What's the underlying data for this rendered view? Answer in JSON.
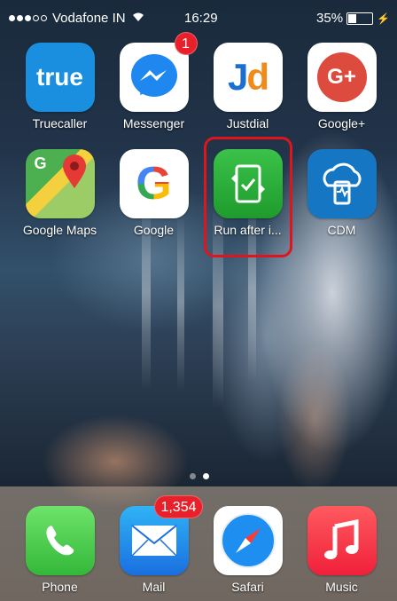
{
  "status_bar": {
    "carrier": "Vodafone IN",
    "time": "16:29",
    "battery": "35%",
    "battery_fraction": 0.35
  },
  "apps": [
    {
      "label": "Truecaller",
      "icon_text": "true",
      "icon": "truecaller-icon"
    },
    {
      "label": "Messenger",
      "badge": "1",
      "icon": "messenger-icon"
    },
    {
      "label": "Justdial",
      "icon_text": "Jd",
      "icon": "justdial-icon"
    },
    {
      "label": "Google+",
      "icon_text": "G+",
      "icon": "google-plus-icon"
    },
    {
      "label": "Google Maps",
      "icon": "google-maps-icon"
    },
    {
      "label": "Google",
      "icon_text": "G",
      "icon": "google-icon"
    },
    {
      "label": "Run after i...",
      "icon": "run-after-icon"
    },
    {
      "label": "CDM",
      "icon": "cdm-icon"
    }
  ],
  "dock": [
    {
      "label": "Phone",
      "icon": "phone-icon"
    },
    {
      "label": "Mail",
      "badge": "1,354",
      "icon": "mail-icon"
    },
    {
      "label": "Safari",
      "icon": "safari-icon"
    },
    {
      "label": "Music",
      "icon": "music-icon"
    }
  ],
  "page_indicator": {
    "pages": 2,
    "active": 2
  },
  "colors": {
    "highlight": "#e0141d",
    "badge": "#e8202a"
  }
}
